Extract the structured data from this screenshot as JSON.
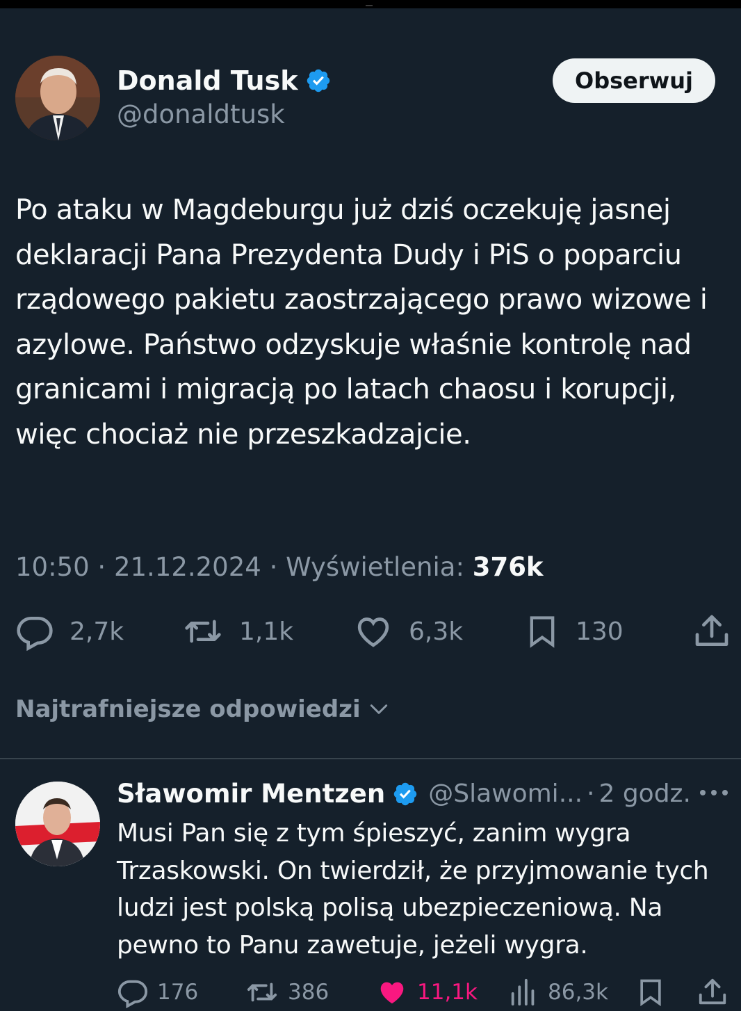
{
  "tweet": {
    "author_name": "Donald Tusk",
    "author_handle": "@donaldtusk",
    "follow_label": "Obserwuj",
    "text": "Po ataku w Magdeburgu już dziś oczekuję jasnej deklaracji Pana Prezydenta Dudy i PiS o poparciu rządowego pakietu zaostrzającego prawo wizowe i azylowe. Państwo odzyskuje właśnie kontrolę nad granicami i migracją po latach chaosu i korupcji, więc chociaż nie przeszkadzajcie.",
    "time": "10:50",
    "date": "21.12.2024",
    "views_label": "Wyświetlenia:",
    "views_count": "376k",
    "replies": "2,7k",
    "reposts": "1,1k",
    "likes": "6,3k",
    "bookmarks": "130"
  },
  "replies_sort": {
    "label": "Najtrafniejsze odpowiedzi"
  },
  "reply": {
    "author_name": "Sławomir Mentzen",
    "author_handle": "@Slawomi...",
    "time_ago": "2 godz.",
    "text": "Musi Pan się z tym śpieszyć, zanim wygra Trzaskowski. On twierdził, że przyjmowanie tych ludzi jest polską polisą ubezpieczeniową. Na pewno to Panu zawetuje, jeżeli wygra.",
    "replies": "176",
    "reposts": "386",
    "likes": "11,1k",
    "views": "86,3k"
  },
  "colors": {
    "background": "#15202b",
    "text_primary": "#f7f9f9",
    "text_secondary": "#8b98a5",
    "verified_blue": "#1d9bf0",
    "like_pink": "#f91880",
    "divider": "#38444d"
  },
  "icons": [
    "verified-badge-icon",
    "reply-icon",
    "repost-icon",
    "like-icon",
    "bookmark-icon",
    "share-icon",
    "chevron-down-icon",
    "more-icon",
    "views-icon"
  ]
}
